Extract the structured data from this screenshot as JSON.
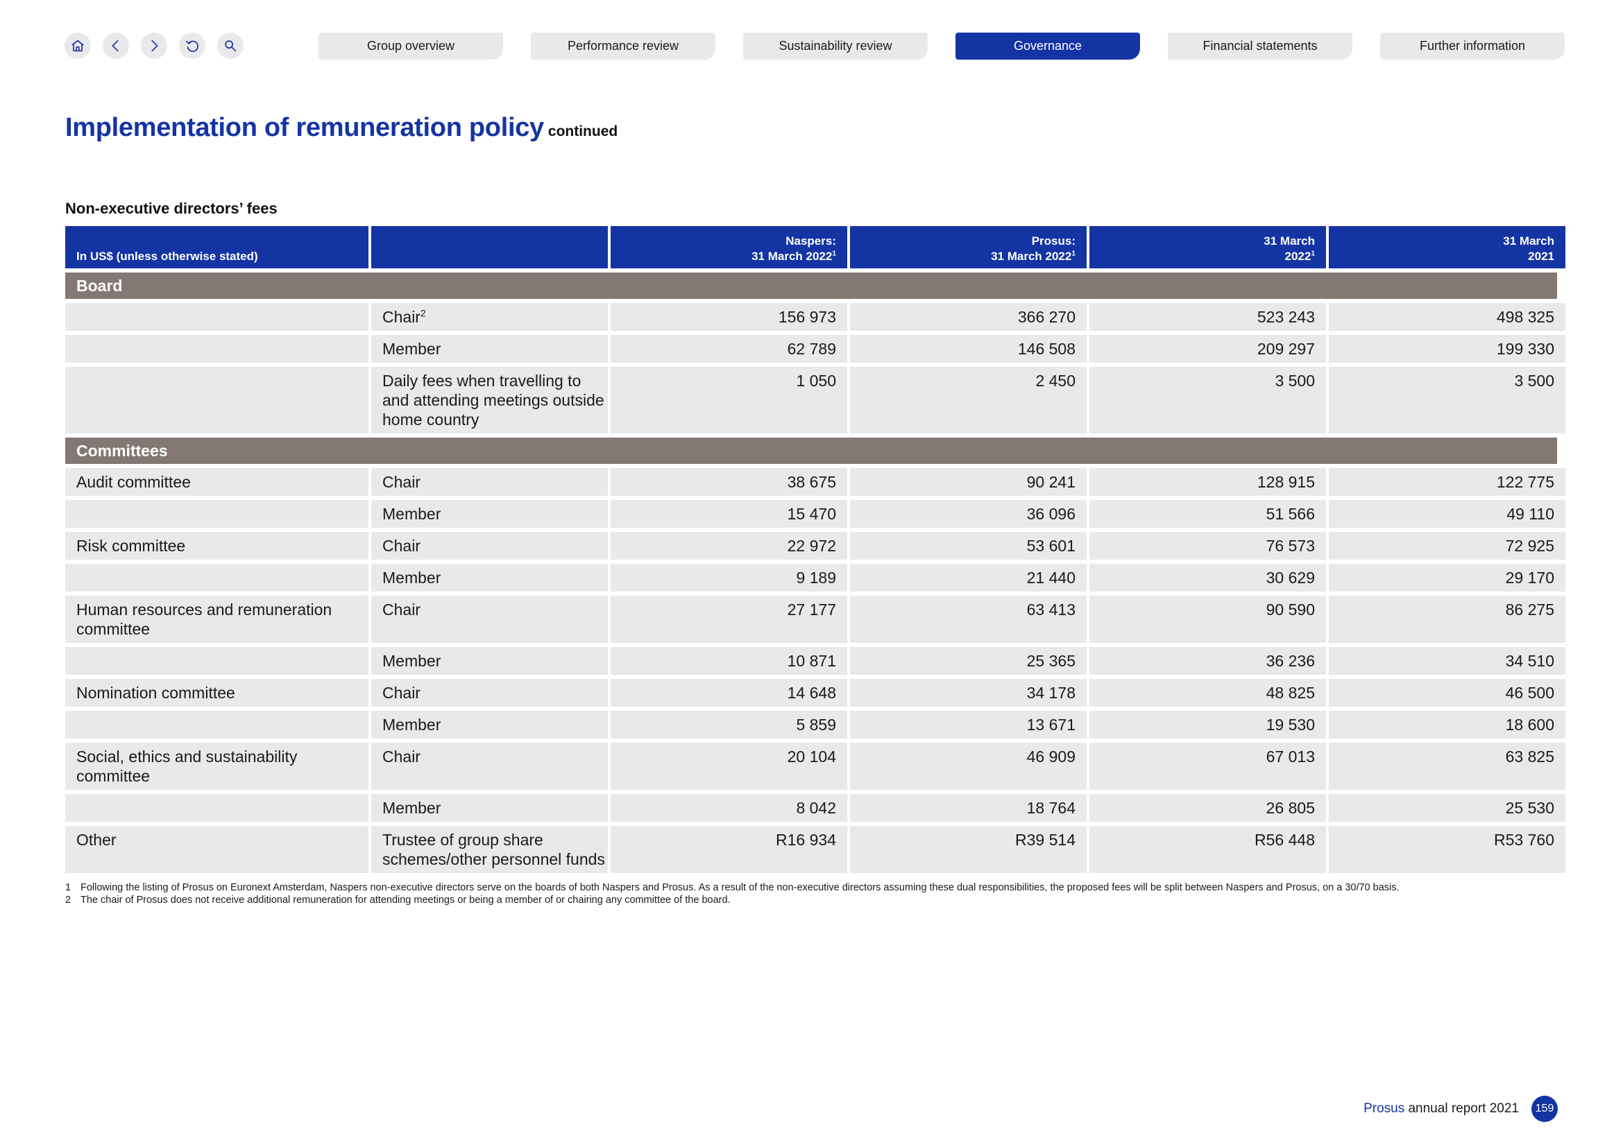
{
  "nav": {
    "icons": [
      "home-icon",
      "back-icon",
      "forward-icon",
      "undo-icon",
      "search-icon"
    ],
    "tabs": [
      {
        "label": "Group overview"
      },
      {
        "label": "Performance review"
      },
      {
        "label": "Sustainability review"
      },
      {
        "label": "Governance",
        "active": true
      },
      {
        "label": "Financial statements"
      },
      {
        "label": "Further information"
      }
    ]
  },
  "page": {
    "title": "Implementation of remuneration policy",
    "title_suffix": "continued",
    "section_title": "Non-executive directors’ fees"
  },
  "table": {
    "header": {
      "col0": "In US$ (unless otherwise stated)",
      "col1": "",
      "col2_line1": "Naspers:",
      "col2_line2": "31 March 2022",
      "col2_sup": "1",
      "col3_line1": "Prosus:",
      "col3_line2": "31 March 2022",
      "col3_sup": "1",
      "col4_line1": "31 March",
      "col4_line2": "2022",
      "col4_sup": "1",
      "col5_line1": "31 March",
      "col5_line2": "2021"
    },
    "sections": [
      {
        "title": "Board",
        "rows": [
          {
            "label": "",
            "role": "Chair",
            "role_sup": "2",
            "naspers": "156 973",
            "prosus": "366 270",
            "mar2022": "523 243",
            "mar2021": "498 325"
          },
          {
            "label": "",
            "role": "Member",
            "naspers": "62 789",
            "prosus": "146 508",
            "mar2022": "209 297",
            "mar2021": "199 330"
          },
          {
            "label": "",
            "role": "Daily fees when travelling to and attending meetings outside home country",
            "naspers": "1 050",
            "prosus": "2 450",
            "mar2022": "3 500",
            "mar2021": "3 500"
          }
        ]
      },
      {
        "title": "Committees",
        "rows": [
          {
            "label": "Audit committee",
            "role": "Chair",
            "naspers": "38 675",
            "prosus": "90 241",
            "mar2022": "128 915",
            "mar2021": "122 775"
          },
          {
            "label": "",
            "role": "Member",
            "naspers": "15 470",
            "prosus": "36 096",
            "mar2022": "51 566",
            "mar2021": "49 110"
          },
          {
            "label": "Risk committee",
            "role": "Chair",
            "naspers": "22 972",
            "prosus": "53 601",
            "mar2022": "76 573",
            "mar2021": "72 925"
          },
          {
            "label": "",
            "role": "Member",
            "naspers": "9 189",
            "prosus": "21 440",
            "mar2022": "30 629",
            "mar2021": "29 170"
          },
          {
            "label": "Human resources and remuneration committee",
            "role": "Chair",
            "naspers": "27 177",
            "prosus": "63 413",
            "mar2022": "90 590",
            "mar2021": "86 275"
          },
          {
            "label": "",
            "role": "Member",
            "naspers": "10 871",
            "prosus": "25 365",
            "mar2022": "36 236",
            "mar2021": "34 510"
          },
          {
            "label": "Nomination committee",
            "role": "Chair",
            "naspers": "14 648",
            "prosus": "34 178",
            "mar2022": "48 825",
            "mar2021": "46 500"
          },
          {
            "label": "",
            "role": "Member",
            "naspers": "5 859",
            "prosus": "13 671",
            "mar2022": "19 530",
            "mar2021": "18 600"
          },
          {
            "label": "Social, ethics and sustainability committee",
            "role": "Chair",
            "naspers": "20 104",
            "prosus": "46 909",
            "mar2022": "67 013",
            "mar2021": "63 825"
          },
          {
            "label": "",
            "role": "Member",
            "naspers": "8 042",
            "prosus": "18 764",
            "mar2022": "26 805",
            "mar2021": "25 530"
          },
          {
            "label": "Other",
            "role": "Trustee of group share schemes/other personnel funds",
            "naspers": "R16 934",
            "prosus": "R39 514",
            "mar2022": "R56 448",
            "mar2021": "R53 760"
          }
        ]
      }
    ]
  },
  "footnotes": [
    {
      "num": "1",
      "text": "Following the listing of Prosus on Euronext Amsterdam, Naspers non-executive directors serve on the boards of both Naspers and Prosus. As a result of the non-executive directors assuming these dual responsibilities, the proposed fees will be split between Naspers and Prosus, on a 30/70 basis."
    },
    {
      "num": "2",
      "text": "The chair of Prosus does not receive additional remuneration for attending meetings or being a member of or chairing any committee of the board."
    }
  ],
  "footer": {
    "brand": "Prosus",
    "report": "annual report 2021",
    "page_number": "159"
  },
  "colors": {
    "brand_blue": "#1434a4",
    "section_bar": "#847874",
    "cell_bg": "#e9e8ea"
  }
}
